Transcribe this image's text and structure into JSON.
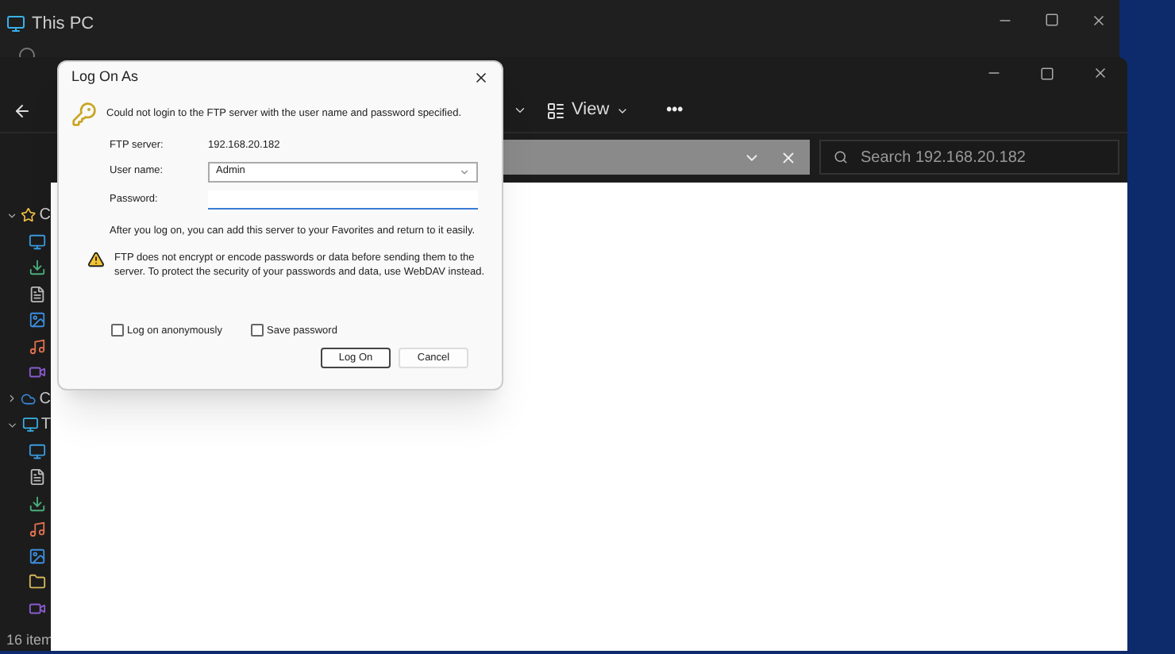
{
  "back_window": {
    "title": "This PC"
  },
  "explorer": {
    "toolbar": {
      "view_label": "View",
      "more_label": "•••"
    },
    "search": {
      "placeholder": "Search 192.168.20.182"
    },
    "nav_items": [
      {
        "label": "C",
        "kind": "star",
        "expanded": true
      },
      {
        "kind": "desktop"
      },
      {
        "kind": "download"
      },
      {
        "kind": "document"
      },
      {
        "kind": "picture"
      },
      {
        "kind": "music"
      },
      {
        "kind": "video"
      },
      {
        "label": "C",
        "kind": "cloud",
        "expanded": false
      },
      {
        "label": "T",
        "kind": "pc",
        "expanded": true
      },
      {
        "kind": "desktop"
      },
      {
        "kind": "document"
      },
      {
        "kind": "download"
      },
      {
        "kind": "music"
      },
      {
        "kind": "picture"
      },
      {
        "kind": "folder"
      },
      {
        "kind": "video"
      }
    ],
    "status": "16 item"
  },
  "dialog": {
    "title": "Log On As",
    "message": "Could not login to the FTP server with the user name and password specified.",
    "server_label": "FTP server:",
    "server_value": "192.168.20.182",
    "user_label": "User name:",
    "user_value": "Admin",
    "password_label": "Password:",
    "info": "After you log on, you can add this server to your Favorites and return to it easily.",
    "warning": "FTP does not encrypt or encode passwords or data before sending them to the server.  To protect the security of your passwords and data, use WebDAV instead.",
    "checkboxes": [
      {
        "label": "Log on anonymously",
        "checked": false
      },
      {
        "label": "Save password",
        "checked": false
      }
    ],
    "buttons": [
      {
        "label": "Log On",
        "selected": true
      },
      {
        "label": "Cancel",
        "selected": false
      }
    ]
  }
}
